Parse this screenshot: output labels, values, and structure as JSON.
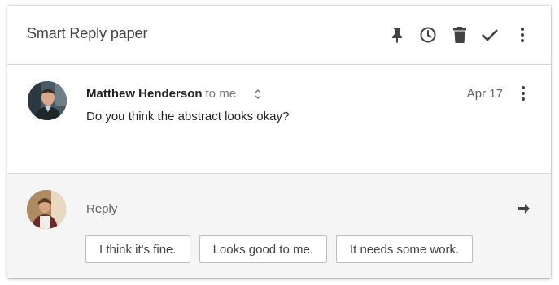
{
  "thread": {
    "subject": "Smart Reply paper",
    "actions": [
      {
        "icon": "pin-icon"
      },
      {
        "icon": "snooze-clock-icon"
      },
      {
        "icon": "trash-icon"
      },
      {
        "icon": "done-check-icon"
      },
      {
        "icon": "more-vert-icon"
      }
    ]
  },
  "message": {
    "sender": "Matthew Henderson",
    "recipient": "to me",
    "date": "Apr 17",
    "body": "Do you think the abstract looks okay?"
  },
  "reply": {
    "label": "Reply",
    "suggestions": [
      "I think it's fine.",
      "Looks good to me.",
      "It needs some work."
    ]
  },
  "colors": {
    "header_text": "#424242",
    "reply_background": "#f5f5f5",
    "icon": "#424242"
  }
}
